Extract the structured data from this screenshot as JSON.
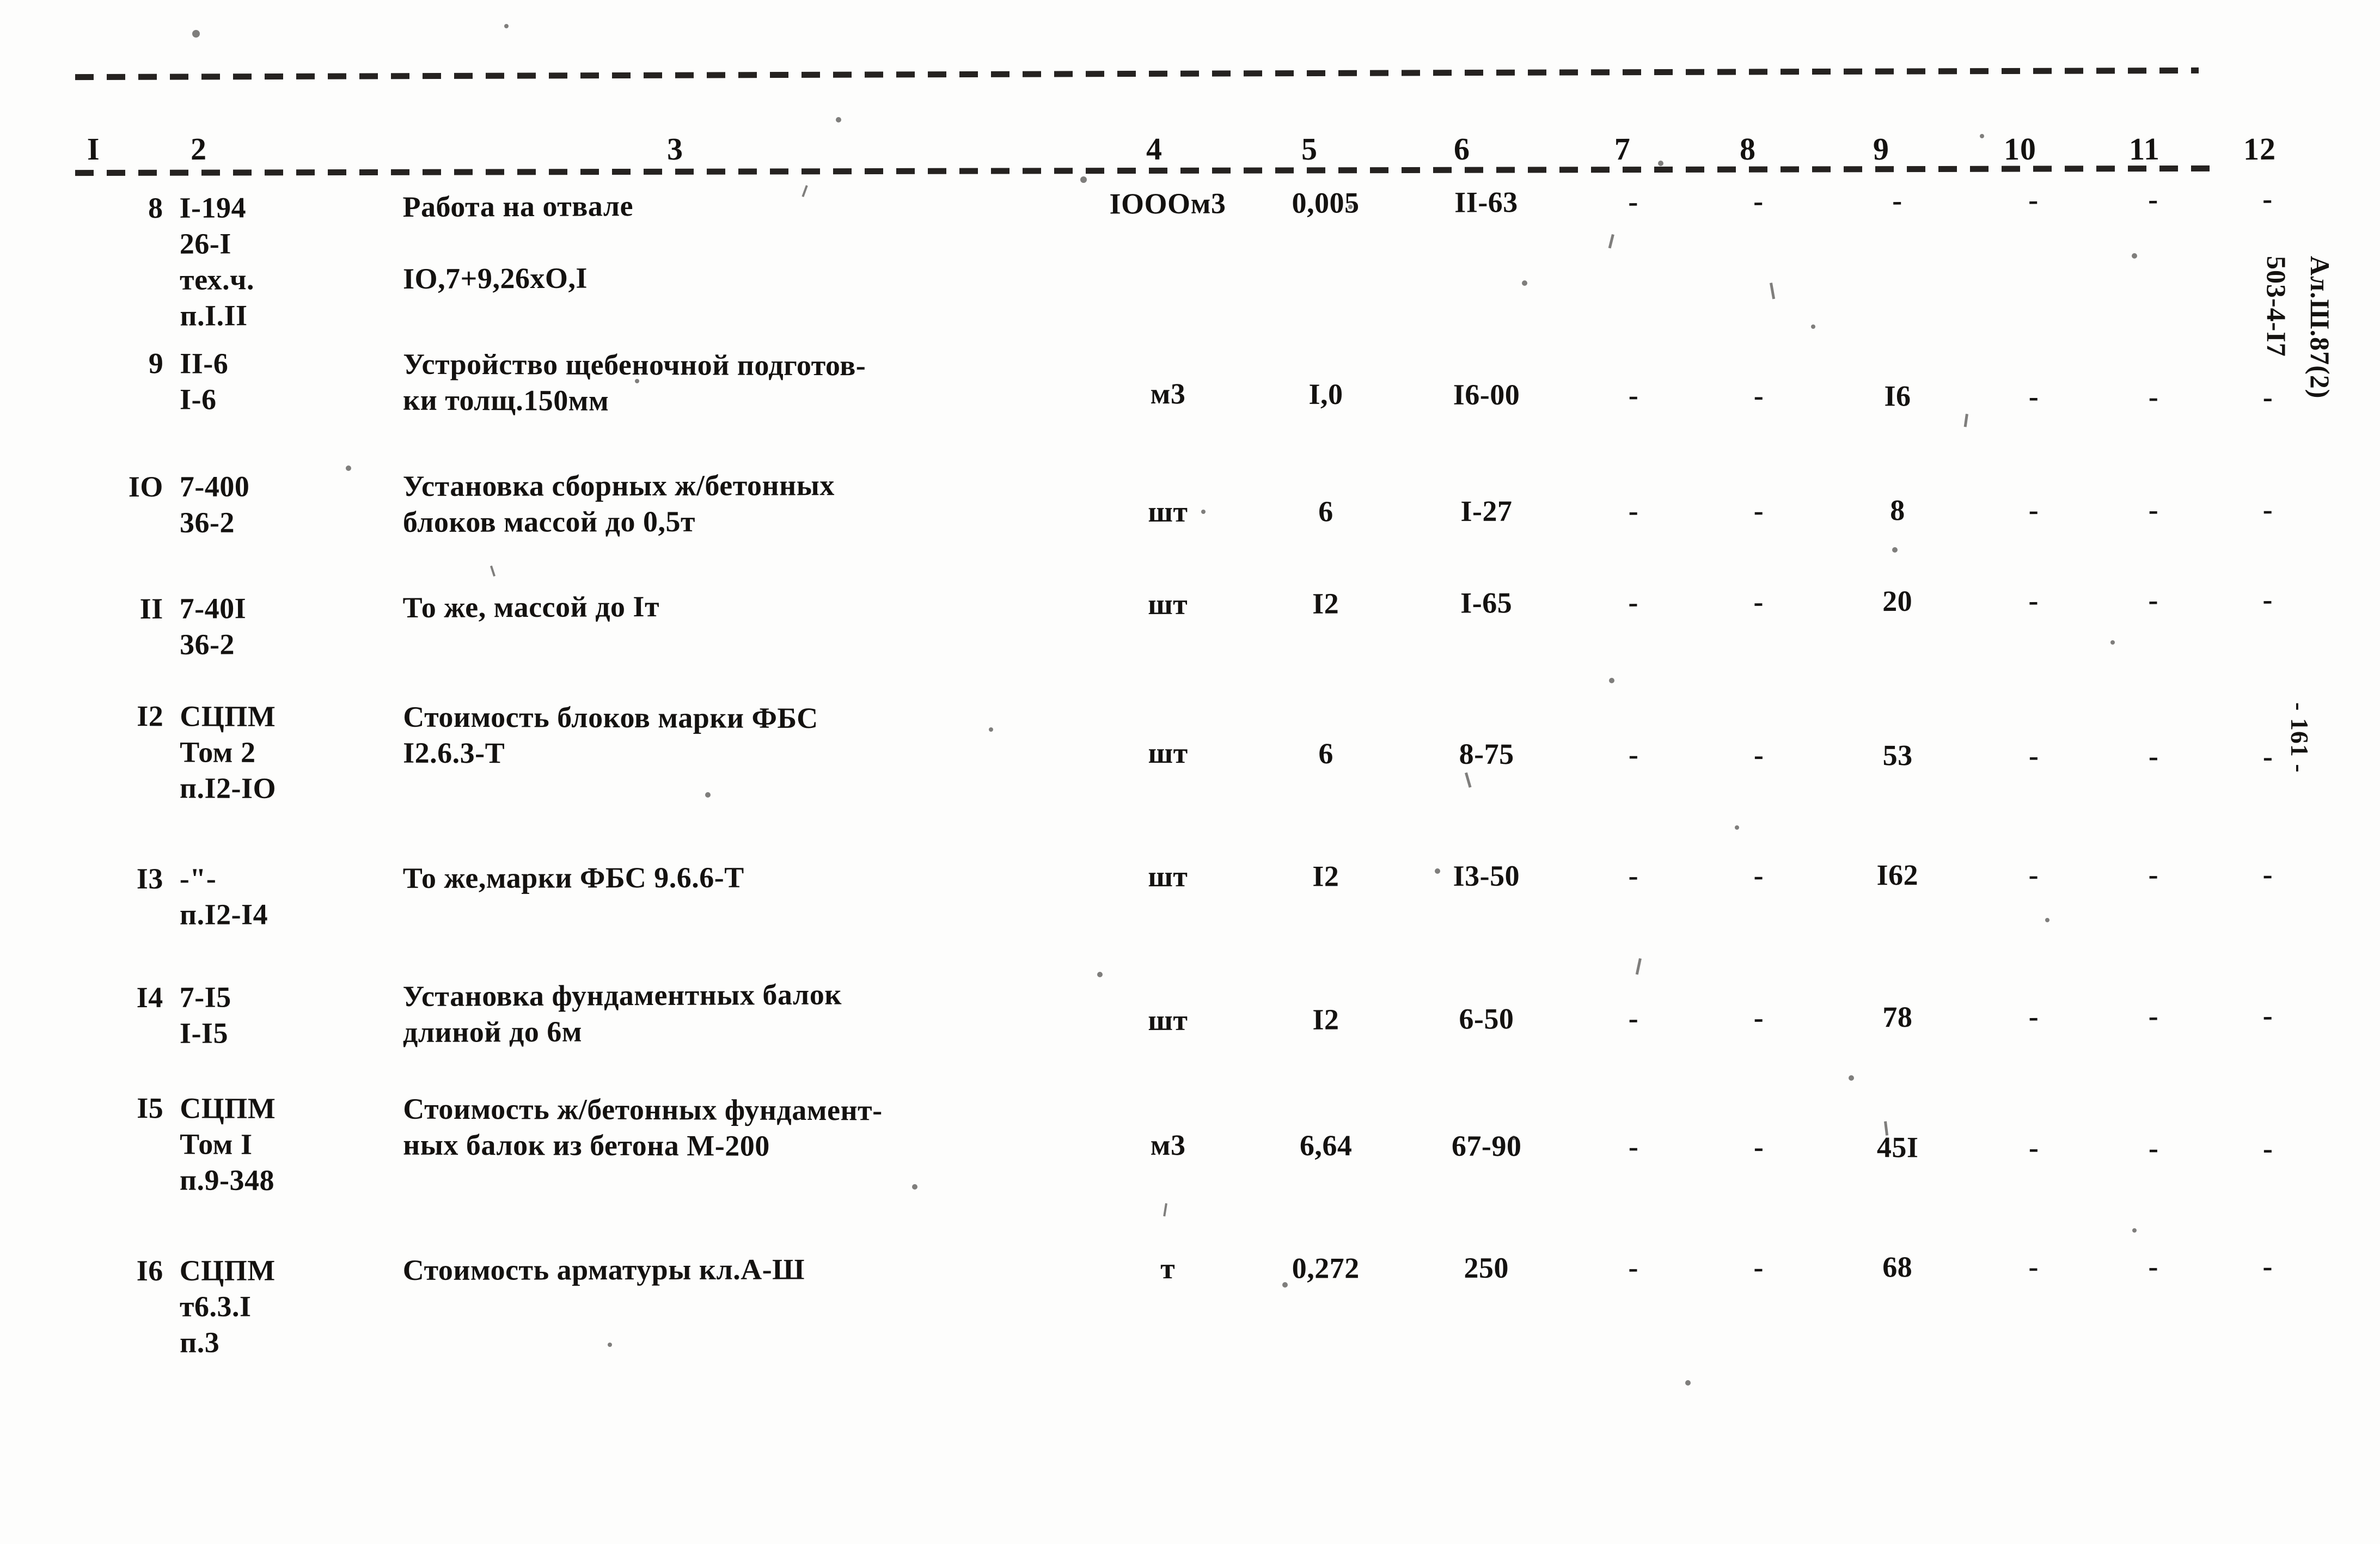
{
  "document": {
    "type": "scanned-estimate-table",
    "margin_stamp_code": "503-4-I7",
    "margin_stamp_code2": "Ал.Ш.87(2)",
    "margin_page_label": "- 161 -"
  },
  "table": {
    "column_headers": [
      "I",
      "2",
      "3",
      "4",
      "5",
      "6",
      "7",
      "8",
      "9",
      "10",
      "11",
      "12"
    ],
    "rows": [
      {
        "no": "8",
        "code": "I-194\n26-I\nтех.ч.\nп.I.II",
        "desc": "Работа на отвале\n\nIО,7+9,26хО,I",
        "unit": "IООOм3",
        "qty": "0,005",
        "price": "II-63",
        "c7": "-",
        "c8": "-",
        "c9": "-",
        "c10": "-",
        "c11": "-",
        "c12": "-"
      },
      {
        "no": "9",
        "code": "II-6\nI-6",
        "desc": "Устройство щебеночной подготов-\nки толщ.150мм",
        "unit": "м3",
        "qty": "I,0",
        "price": "I6-00",
        "c7": "-",
        "c8": "-",
        "c9": "I6",
        "c10": "-",
        "c11": "-",
        "c12": "-"
      },
      {
        "no": "IО",
        "code": "7-400\n36-2",
        "desc": "Установка сборных ж/бетонных\nблоков массой до 0,5т",
        "unit": "шт",
        "qty": "6",
        "price": "I-27",
        "c7": "-",
        "c8": "-",
        "c9": "8",
        "c10": "-",
        "c11": "-",
        "c12": "-"
      },
      {
        "no": "II",
        "code": "7-40I\n36-2",
        "desc": "То же, массой до Iт",
        "unit": "шт",
        "qty": "I2",
        "price": "I-65",
        "c7": "-",
        "c8": "-",
        "c9": "20",
        "c10": "-",
        "c11": "-",
        "c12": "-"
      },
      {
        "no": "I2",
        "code": "СЦПМ\nТом 2\nп.I2-IО",
        "desc": "Стоимость блоков марки ФБС\nI2.6.3-Т",
        "unit": "шт",
        "qty": "6",
        "price": "8-75",
        "c7": "-",
        "c8": "-",
        "c9": "53",
        "c10": "-",
        "c11": "-",
        "c12": "-"
      },
      {
        "no": "I3",
        "code": "-\"-\nп.I2-I4",
        "desc": "То же,марки ФБС 9.6.6-Т",
        "unit": "шт",
        "qty": "I2",
        "price": "I3-50",
        "c7": "-",
        "c8": "-",
        "c9": "I62",
        "c10": "-",
        "c11": "-",
        "c12": "-"
      },
      {
        "no": "I4",
        "code": "7-I5\nI-I5",
        "desc": "Установка фундаментных балок\nдлиной до 6м",
        "unit": "шт",
        "qty": "I2",
        "price": "6-50",
        "c7": "-",
        "c8": "-",
        "c9": "78",
        "c10": "-",
        "c11": "-",
        "c12": "-"
      },
      {
        "no": "I5",
        "code": "СЦПМ\nТом I\nп.9-348",
        "desc": "Стоимость ж/бетонных фундамент-\nных балок из бетона М-200",
        "unit": "м3",
        "qty": "6,64",
        "price": "67-90",
        "c7": "-",
        "c8": "-",
        "c9": "45I",
        "c10": "-",
        "c11": "-",
        "c12": "-"
      },
      {
        "no": "I6",
        "code": "СЦПМ\nт6.3.I\nп.3",
        "desc": "Стоимость арматуры кл.А-Ш",
        "unit": "т",
        "qty": "0,272",
        "price": "250",
        "c7": "-",
        "c8": "-",
        "c9": "68",
        "c10": "-",
        "c11": "-",
        "c12": "-"
      }
    ]
  },
  "colors": {
    "ink": "#141210",
    "paper": "#fdfdfc"
  }
}
